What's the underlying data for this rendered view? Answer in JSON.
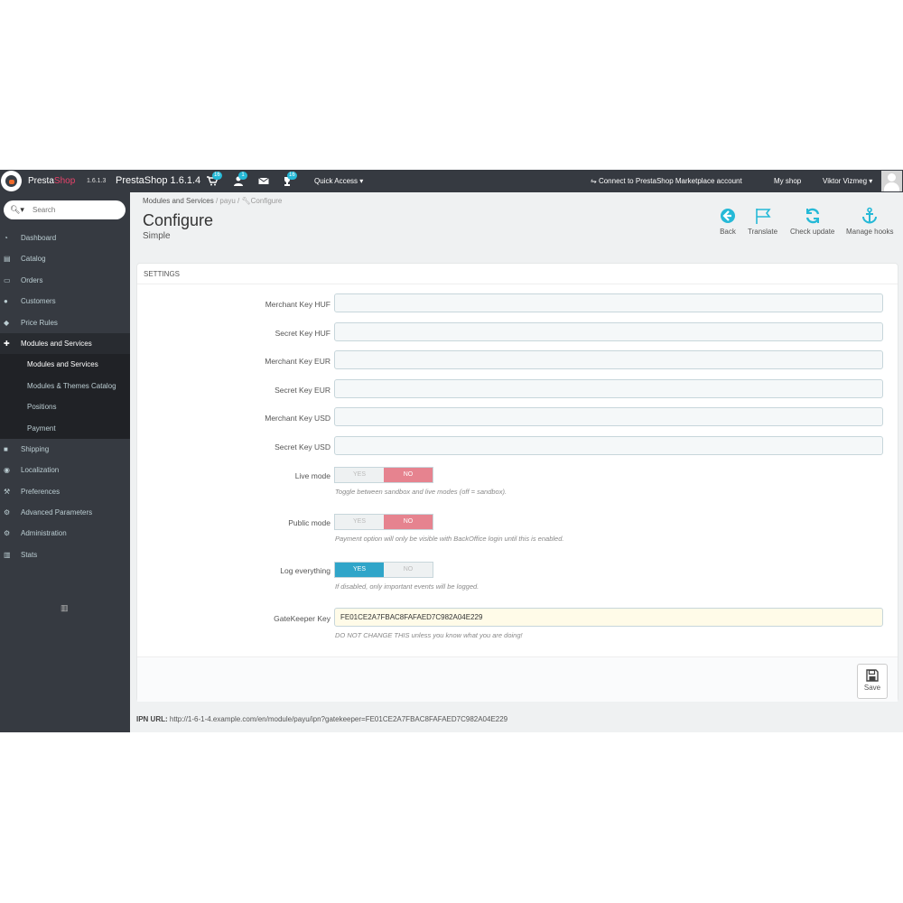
{
  "topbar": {
    "brand_presta": "Presta",
    "brand_shop": "Shop",
    "version": "1.6.1.3",
    "shop_name": "PrestaShop 1.6.1.4",
    "cart_badge": "16",
    "customers_badge": "1",
    "messages_badge": "16",
    "quick_access": "Quick Access ▾",
    "connect_label": "Connect to PrestaShop Marketplace account",
    "my_shop": "My shop",
    "user_name": "Viktor Vizmeg ▾"
  },
  "sidebar": {
    "search_placeholder": "Search",
    "items": [
      {
        "label": "Dashboard",
        "icon": "dashboard-icon"
      },
      {
        "label": "Catalog",
        "icon": "book-icon"
      },
      {
        "label": "Orders",
        "icon": "credit-card-icon"
      },
      {
        "label": "Customers",
        "icon": "users-icon"
      },
      {
        "label": "Price Rules",
        "icon": "tags-icon"
      },
      {
        "label": "Modules and Services",
        "icon": "puzzle-icon"
      }
    ],
    "subitems": [
      {
        "label": "Modules and Services"
      },
      {
        "label": "Modules & Themes Catalog"
      },
      {
        "label": "Positions"
      },
      {
        "label": "Payment"
      }
    ],
    "items2": [
      {
        "label": "Shipping",
        "icon": "truck-icon"
      },
      {
        "label": "Localization",
        "icon": "globe-icon"
      },
      {
        "label": "Preferences",
        "icon": "wrench-icon"
      },
      {
        "label": "Advanced Parameters",
        "icon": "cogs-icon"
      },
      {
        "label": "Administration",
        "icon": "cog-icon"
      },
      {
        "label": "Stats",
        "icon": "bar-chart-icon"
      }
    ]
  },
  "breadcrumb": {
    "first": "Modules and Services",
    "sep": "/",
    "second": "payu",
    "third": "Configure"
  },
  "page": {
    "title": "Configure",
    "subtitle": "Simple"
  },
  "toolbar": {
    "back": "Back",
    "translate": "Translate",
    "check_update": "Check update",
    "manage_hooks": "Manage hooks"
  },
  "panel": {
    "heading": "SETTINGS",
    "fields": [
      {
        "label": "Merchant Key HUF",
        "value": ""
      },
      {
        "label": "Secret Key HUF",
        "value": ""
      },
      {
        "label": "Merchant Key EUR",
        "value": ""
      },
      {
        "label": "Secret Key EUR",
        "value": ""
      },
      {
        "label": "Merchant Key USD",
        "value": ""
      },
      {
        "label": "Secret Key USD",
        "value": ""
      }
    ],
    "switches": [
      {
        "label": "Live mode",
        "yes": "YES",
        "no": "NO",
        "value": "NO",
        "help": "Toggle between sandbox and live modes (off = sandbox)."
      },
      {
        "label": "Public mode",
        "yes": "YES",
        "no": "NO",
        "value": "NO",
        "help": "Payment option will only be visible with BackOffice login until this is enabled."
      },
      {
        "label": "Log everything",
        "yes": "YES",
        "no": "NO",
        "value": "YES",
        "help": "If disabled, only important events will be logged."
      }
    ],
    "gatekeeper": {
      "label": "GateKeeper Key",
      "value": "FE01CE2A7FBAC8FAFAED7C982A04E229",
      "help": "DO NOT CHANGE THIS unless you know what you are doing!"
    },
    "save_label": "Save"
  },
  "ipn": {
    "label": "IPN URL:",
    "url": "http://1-6-1-4.example.com/en/module/payu/ipn?gatekeeper=FE01CE2A7FBAC8FAFAED7C982A04E229"
  },
  "colors": {
    "topbar": "#363a41",
    "accent": "#25b9d7",
    "switch_no": "#e6838f",
    "switch_yes": "#30a5c9"
  }
}
